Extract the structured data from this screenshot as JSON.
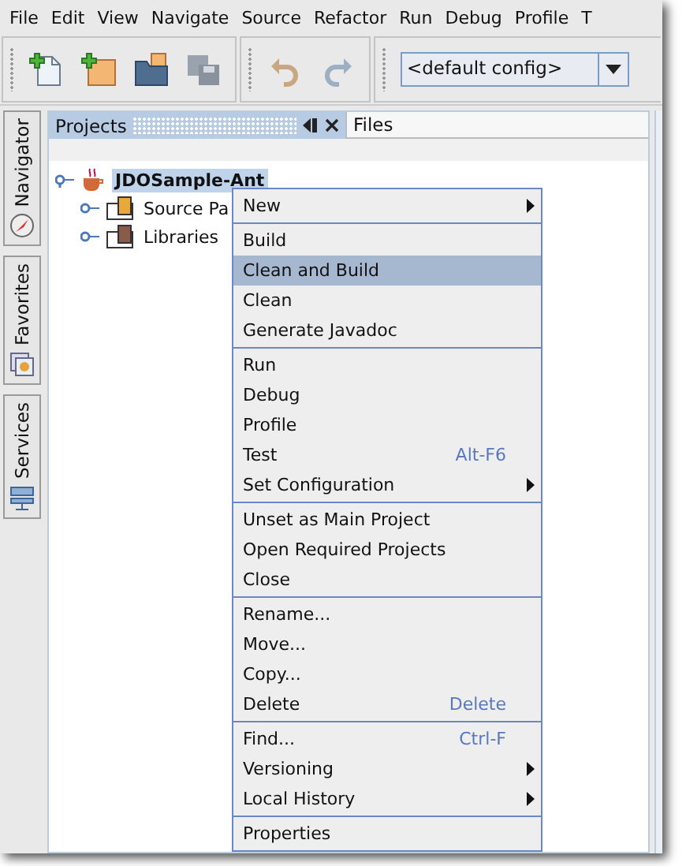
{
  "menu_bar": [
    "File",
    "Edit",
    "View",
    "Navigate",
    "Source",
    "Refactor",
    "Run",
    "Debug",
    "Profile",
    "T"
  ],
  "toolbar": {
    "config": "<default config>"
  },
  "side_tabs": [
    {
      "label": "Navigator"
    },
    {
      "label": "Favorites"
    },
    {
      "label": "Services"
    }
  ],
  "tabs": [
    {
      "label": "Projects",
      "selected": true
    },
    {
      "label": "Files",
      "selected": false
    }
  ],
  "tree": [
    {
      "label": "JDOSample-Ant",
      "selected": true,
      "expanded": true,
      "children": [
        {
          "label": "Source Pa",
          "selected": false,
          "expanded": false
        },
        {
          "label": "Libraries",
          "selected": false,
          "expanded": false
        }
      ]
    }
  ],
  "context_menu": {
    "groups": [
      [
        {
          "label": "New",
          "submenu": true,
          "selected": false
        }
      ],
      [
        {
          "label": "Build",
          "submenu": false,
          "selected": false
        },
        {
          "label": "Clean and Build",
          "submenu": false,
          "selected": true
        },
        {
          "label": "Clean",
          "submenu": false,
          "selected": false
        },
        {
          "label": "Generate Javadoc",
          "submenu": false,
          "selected": false
        }
      ],
      [
        {
          "label": "Run",
          "submenu": false,
          "selected": false
        },
        {
          "label": "Debug",
          "submenu": false,
          "selected": false
        },
        {
          "label": "Profile",
          "submenu": false,
          "selected": false
        },
        {
          "label": "Test",
          "shortcut": "Alt-F6",
          "submenu": false,
          "selected": false
        },
        {
          "label": "Set Configuration",
          "submenu": true,
          "selected": false
        }
      ],
      [
        {
          "label": "Unset as Main Project",
          "submenu": false,
          "selected": false
        },
        {
          "label": "Open Required Projects",
          "submenu": false,
          "selected": false
        },
        {
          "label": "Close",
          "submenu": false,
          "selected": false
        }
      ],
      [
        {
          "label": "Rename...",
          "submenu": false,
          "selected": false
        },
        {
          "label": "Move...",
          "submenu": false,
          "selected": false
        },
        {
          "label": "Copy...",
          "submenu": false,
          "selected": false
        },
        {
          "label": "Delete",
          "shortcut": "Delete",
          "submenu": false,
          "selected": false
        }
      ],
      [
        {
          "label": "Find...",
          "shortcut": "Ctrl-F",
          "submenu": false,
          "selected": false
        },
        {
          "label": "Versioning",
          "submenu": true,
          "selected": false
        },
        {
          "label": "Local History",
          "submenu": true,
          "selected": false
        }
      ],
      [
        {
          "label": "Properties",
          "submenu": false,
          "selected": false
        }
      ]
    ]
  }
}
